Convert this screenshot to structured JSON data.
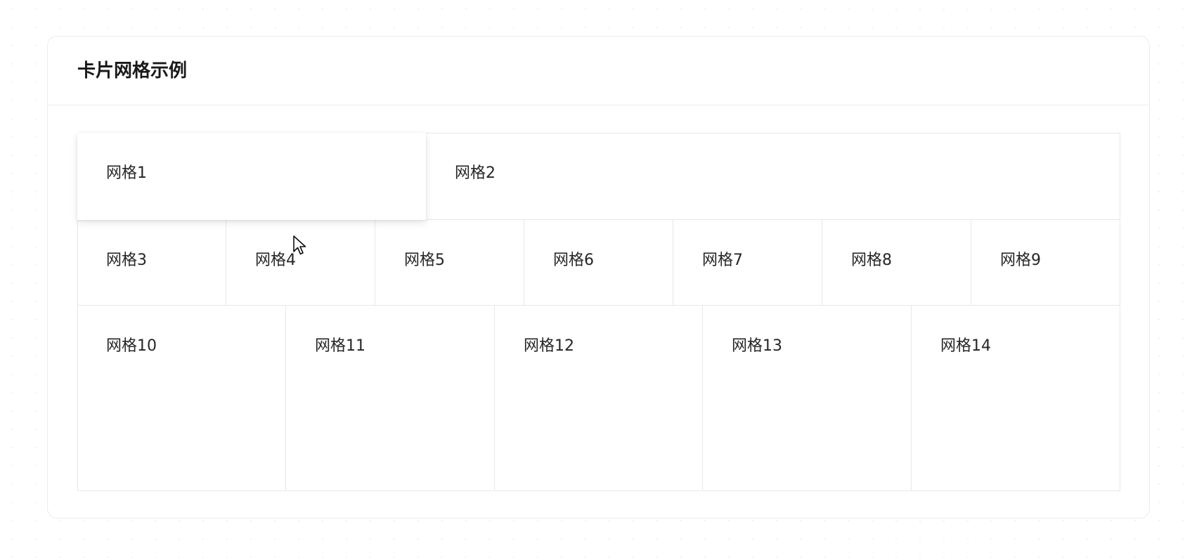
{
  "card": {
    "title": "卡片网格示例"
  },
  "grid": {
    "hovered_item": "网格1",
    "rows": [
      {
        "items": [
          "网格1",
          "网格2"
        ]
      },
      {
        "items": [
          "网格3",
          "网格4",
          "网格5",
          "网格6",
          "网格7",
          "网格8",
          "网格9"
        ]
      },
      {
        "items": [
          "网格10",
          "网格11",
          "网格12",
          "网格13",
          "网格14"
        ]
      }
    ]
  },
  "colors": {
    "background": "#ffffff",
    "border": "#e8e8e8",
    "text": "#262626"
  },
  "icons": {
    "cursor": "mouse-pointer-icon"
  }
}
